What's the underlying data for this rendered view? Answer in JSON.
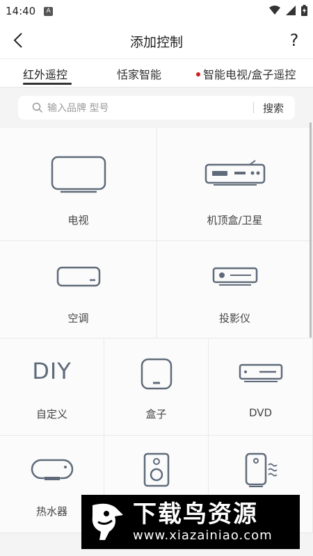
{
  "status_bar": {
    "time": "14:40",
    "app_badge": "A"
  },
  "header": {
    "title": "添加控制",
    "help_label": "?"
  },
  "tabs": [
    {
      "label": "红外遥控",
      "active": true
    },
    {
      "label": "恬家智能",
      "active": false
    },
    {
      "label": "智能电视/盒子遥控",
      "active": false,
      "has_dot": true
    }
  ],
  "search": {
    "placeholder": "输入品牌 型号",
    "button_label": "搜索"
  },
  "devices": [
    {
      "label": "电视",
      "icon": "tv-icon"
    },
    {
      "label": "机顶盒/卫星",
      "icon": "set-top-box-icon"
    },
    {
      "label": "空调",
      "icon": "air-conditioner-icon"
    },
    {
      "label": "投影仪",
      "icon": "projector-icon"
    },
    {
      "label": "自定义",
      "icon": "diy-icon",
      "icon_text": "DIY"
    },
    {
      "label": "盒子",
      "icon": "box-icon"
    },
    {
      "label": "DVD",
      "icon": "dvd-icon"
    },
    {
      "label": "热水器",
      "icon": "water-heater-icon"
    },
    {
      "label": "",
      "icon": "speaker-icon"
    },
    {
      "label": "",
      "icon": "air-purifier-icon"
    }
  ],
  "watermark": {
    "title": "下载鸟资源",
    "url": "www.xiazainiao.com"
  },
  "colors": {
    "icon": "#5f6b7a",
    "accent_dot": "#d71920",
    "background": "#f4f4f4"
  }
}
